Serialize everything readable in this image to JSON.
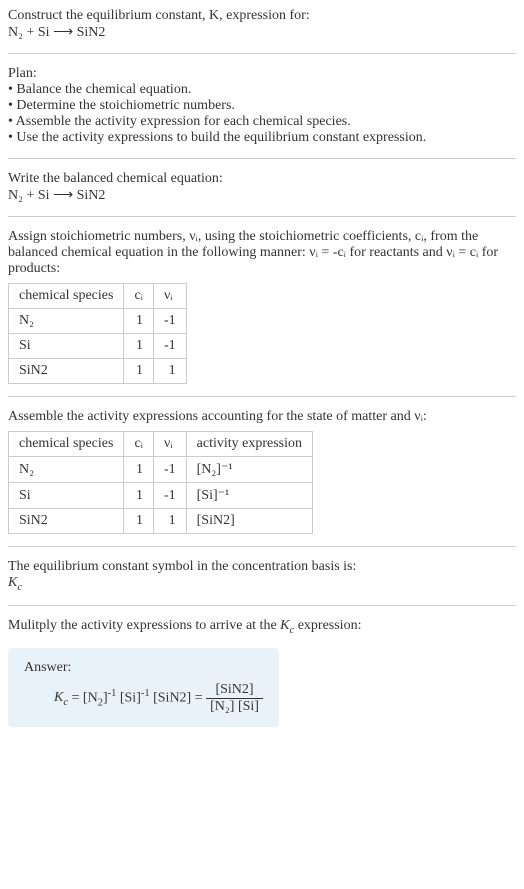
{
  "header": {
    "line1": "Construct the equilibrium constant, K, expression for:",
    "equation": "N₂ + Si ⟶ SiN2"
  },
  "plan": {
    "title": "Plan:",
    "items": [
      "• Balance the chemical equation.",
      "• Determine the stoichiometric numbers.",
      "• Assemble the activity expression for each chemical species.",
      "• Use the activity expressions to build the equilibrium constant expression."
    ]
  },
  "balanced": {
    "title": "Write the balanced chemical equation:",
    "equation": "N₂ + Si ⟶ SiN2"
  },
  "stoich": {
    "intro": "Assign stoichiometric numbers, νᵢ, using the stoichiometric coefficients, cᵢ, from the balanced chemical equation in the following manner: νᵢ = -cᵢ for reactants and νᵢ = cᵢ for products:",
    "headers": {
      "h1": "chemical species",
      "h2": "cᵢ",
      "h3": "νᵢ"
    },
    "rows": [
      {
        "species": "N₂",
        "c": "1",
        "nu": "-1"
      },
      {
        "species": "Si",
        "c": "1",
        "nu": "-1"
      },
      {
        "species": "SiN2",
        "c": "1",
        "nu": "1"
      }
    ]
  },
  "activity": {
    "intro": "Assemble the activity expressions accounting for the state of matter and νᵢ:",
    "headers": {
      "h1": "chemical species",
      "h2": "cᵢ",
      "h3": "νᵢ",
      "h4": "activity expression"
    },
    "rows": [
      {
        "species": "N₂",
        "c": "1",
        "nu": "-1",
        "expr": "[N₂]⁻¹"
      },
      {
        "species": "Si",
        "c": "1",
        "nu": "-1",
        "expr": "[Si]⁻¹"
      },
      {
        "species": "SiN2",
        "c": "1",
        "nu": "1",
        "expr": "[SiN2]"
      }
    ]
  },
  "symbol": {
    "title": "The equilibrium constant symbol in the concentration basis is:",
    "value": "K_c"
  },
  "multiply": {
    "title": "Mulitply the activity expressions to arrive at the K_c expression:"
  },
  "answer": {
    "label": "Answer:",
    "lhs": "K_c = [N₂]⁻¹ [Si]⁻¹ [SiN2] =",
    "frac_top": "[SiN2]",
    "frac_bot": "[N₂] [Si]"
  },
  "chart_data": {
    "type": "table",
    "tables": [
      {
        "name": "stoichiometric_numbers",
        "columns": [
          "chemical species",
          "c_i",
          "nu_i"
        ],
        "rows": [
          [
            "N2",
            1,
            -1
          ],
          [
            "Si",
            1,
            -1
          ],
          [
            "SiN2",
            1,
            1
          ]
        ]
      },
      {
        "name": "activity_expressions",
        "columns": [
          "chemical species",
          "c_i",
          "nu_i",
          "activity expression"
        ],
        "rows": [
          [
            "N2",
            1,
            -1,
            "[N2]^-1"
          ],
          [
            "Si",
            1,
            -1,
            "[Si]^-1"
          ],
          [
            "SiN2",
            1,
            1,
            "[SiN2]"
          ]
        ]
      }
    ]
  }
}
